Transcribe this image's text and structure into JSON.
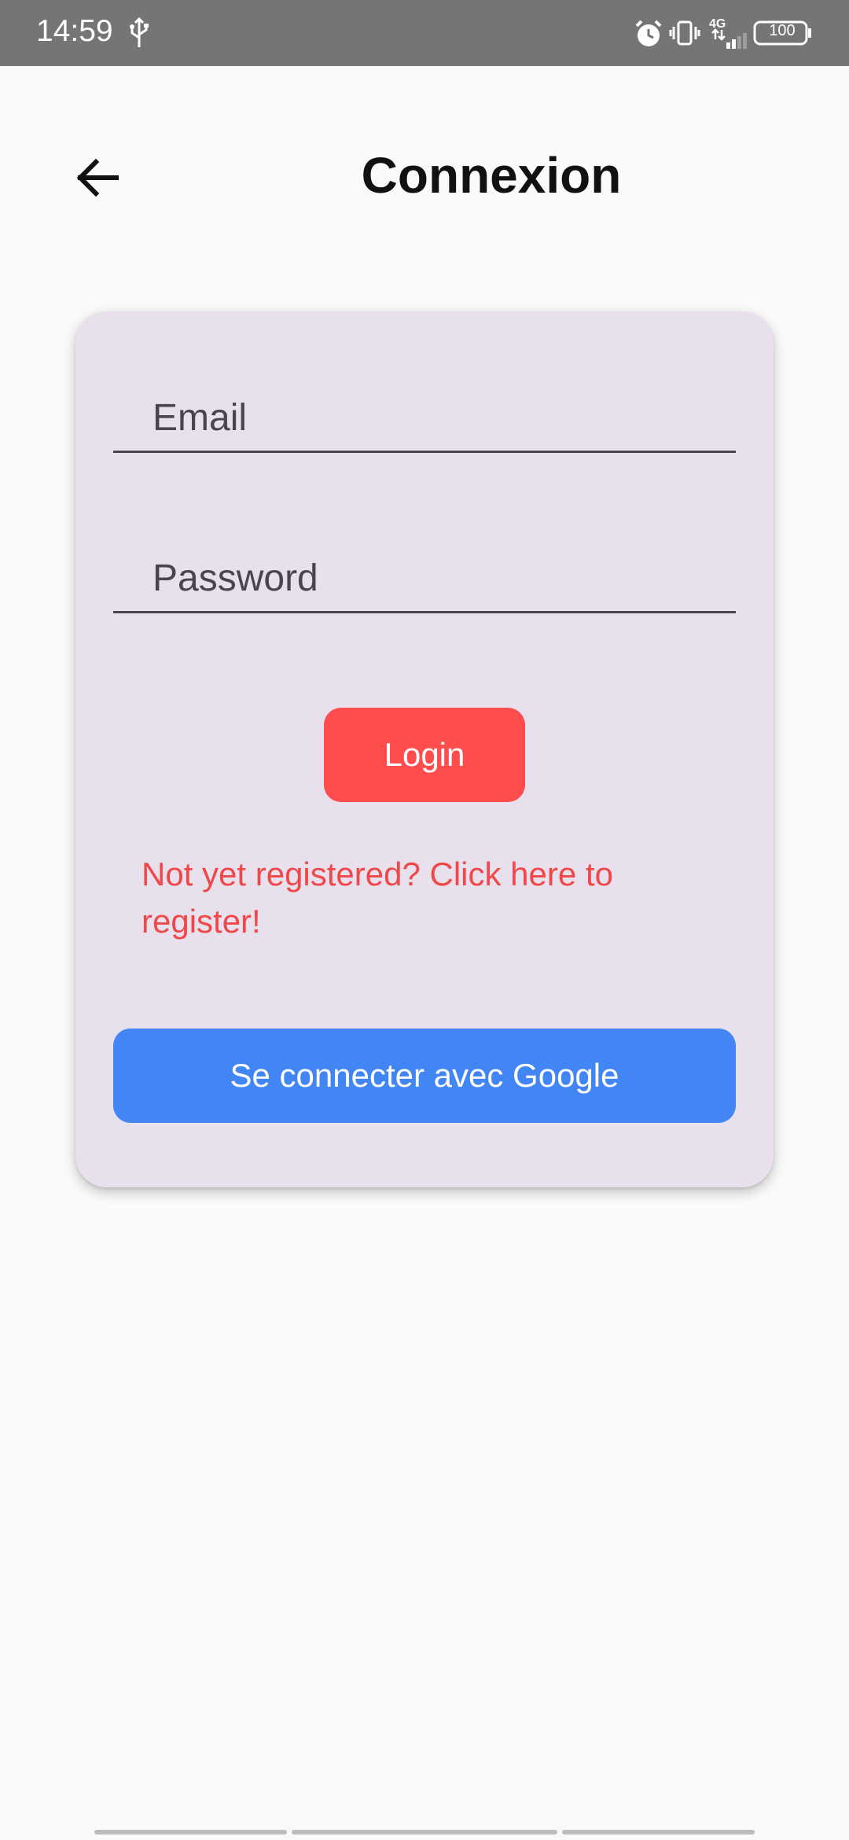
{
  "status_bar": {
    "time": "14:59",
    "network": "4G",
    "battery": "100",
    "icons": [
      "usb-icon",
      "alarm-icon",
      "vibrate-icon",
      "signal-icon",
      "battery-icon"
    ]
  },
  "app_bar": {
    "title": "Connexion",
    "back_icon": "arrow-left-icon"
  },
  "form": {
    "email_label": "Email",
    "password_label": "Password",
    "login_label": "Login",
    "register_text": "Not yet registered? Click here to register!",
    "google_label": "Se connecter avec Google"
  },
  "colors": {
    "status_bar": "#757575",
    "background": "#fafafa",
    "card": "#e8e0ec",
    "login_button": "#ff4d4d",
    "register_text": "#f04848",
    "google_button": "#4285f4",
    "field_underline": "#49454f"
  }
}
